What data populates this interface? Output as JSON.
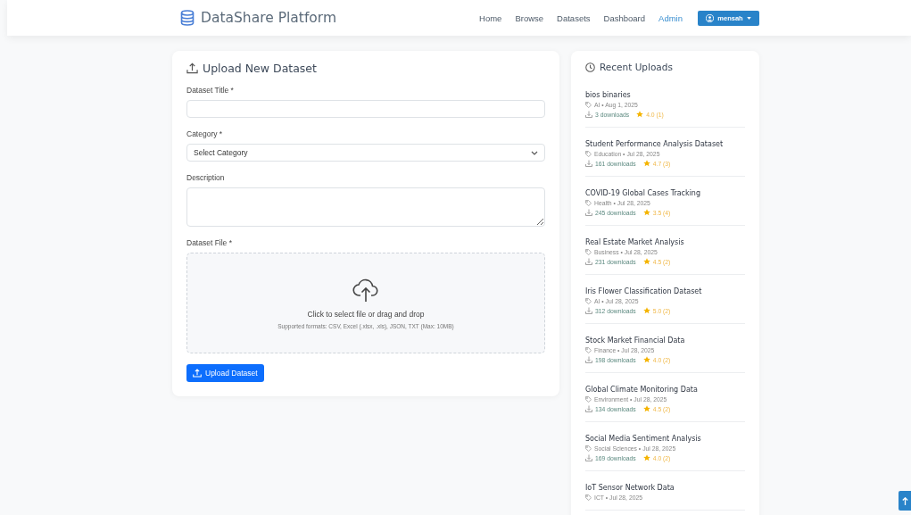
{
  "brand": "DataShare Platform",
  "nav": [
    {
      "label": "Home",
      "selected": false
    },
    {
      "label": "Browse",
      "selected": false
    },
    {
      "label": "Datasets",
      "selected": false
    },
    {
      "label": "Dashboard",
      "selected": false
    },
    {
      "label": "Admin",
      "selected": true
    }
  ],
  "user_button": {
    "label": "mensah"
  },
  "upload_form": {
    "title": "Upload New Dataset",
    "fields": [
      {
        "kind": "text",
        "label": "Dataset Title *"
      },
      {
        "kind": "select",
        "label": "Category *",
        "value": "Select Category"
      },
      {
        "kind": "textarea",
        "label": "Description"
      },
      {
        "kind": "file",
        "label": "Dataset File *",
        "prompt": "Click to select file or drag and drop",
        "hint": "Supported formats: CSV, Excel (.xlsx, .xls), JSON, TXT (Max: 10MB)"
      }
    ],
    "submit": "Upload Dataset"
  },
  "recent_uploads": {
    "title": "Recent Uploads",
    "items": [
      {
        "title": "bios binaries",
        "meta": "AI • Aug 1, 2025",
        "downloads": "3 downloads",
        "rating": "4.0 (1)"
      },
      {
        "title": "Student Performance Analysis Dataset",
        "meta": "Education • Jul 28, 2025",
        "downloads": "161 downloads",
        "rating": "4.7 (3)"
      },
      {
        "title": "COVID-19 Global Cases Tracking",
        "meta": "Health • Jul 28, 2025",
        "downloads": "245 downloads",
        "rating": "3.5 (4)"
      },
      {
        "title": "Real Estate Market Analysis",
        "meta": "Business • Jul 28, 2025",
        "downloads": "231 downloads",
        "rating": "4.5 (2)"
      },
      {
        "title": "Iris Flower Classification Dataset",
        "meta": "AI • Jul 28, 2025",
        "downloads": "312 downloads",
        "rating": "5.0 (2)"
      },
      {
        "title": "Stock Market Financial Data",
        "meta": "Finance • Jul 28, 2025",
        "downloads": "198 downloads",
        "rating": "4.0 (2)"
      },
      {
        "title": "Global Climate Monitoring Data",
        "meta": "Environment • Jul 28, 2025",
        "downloads": "134 downloads",
        "rating": "4.5 (2)"
      },
      {
        "title": "Social Media Sentiment Analysis",
        "meta": "Social Sciences • Jul 28, 2025",
        "downloads": "169 downloads",
        "rating": "4.0 (2)"
      },
      {
        "title": "IoT Sensor Network Data",
        "meta": "ICT • Jul 28, 2025"
      }
    ]
  }
}
